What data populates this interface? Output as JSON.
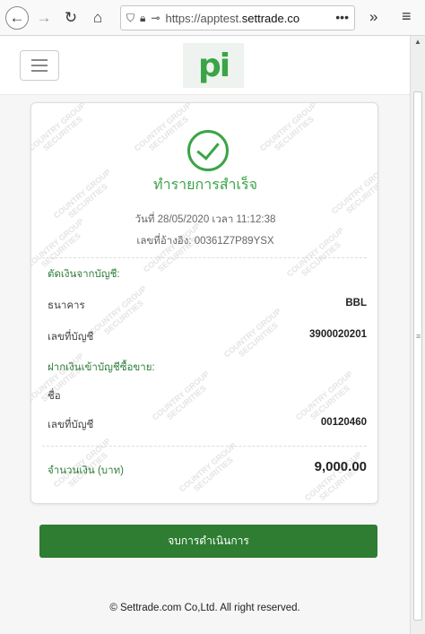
{
  "browser": {
    "url_prefix": "https://apptest.",
    "url_domain": "settrade.co",
    "url_suffix": "m",
    "dots": "•••",
    "extensions": "»",
    "menu": "≡"
  },
  "app": {
    "logo_text": "pi"
  },
  "receipt": {
    "title": "ทำรายการสำเร็จ",
    "datetime": "วันที่ 28/05/2020 เวลา 11:12:38",
    "reference": "เลขที่อ้างอิง: 00361Z7P89YSX",
    "debit_section": "ตัดเงินจากบัญชี:",
    "debit_bank_label": "ธนาคาร",
    "debit_bank_value": "BBL",
    "debit_account_label": "เลขที่บัญชี",
    "debit_account_value": "3900020201",
    "credit_section": "ฝากเงินเข้าบัญชีซื้อขาย:",
    "credit_name_label": "ชื่อ",
    "credit_name_value": "",
    "credit_account_label": "เลขที่บัญชี",
    "credit_account_value": "00120460",
    "amount_label": "จำนวนเงิน (บาท)",
    "amount_value": "9,000.00"
  },
  "watermark": {
    "line1": "COUNTRY GROUP",
    "line2": "SECURITIES"
  },
  "actions": {
    "finish_label": "จบการดำเนินการ"
  },
  "footer": {
    "copyright": "© Settrade.com Co,Ltd. All right reserved."
  },
  "colors": {
    "brand_green": "#3aa447",
    "button_green": "#2e7d32"
  }
}
